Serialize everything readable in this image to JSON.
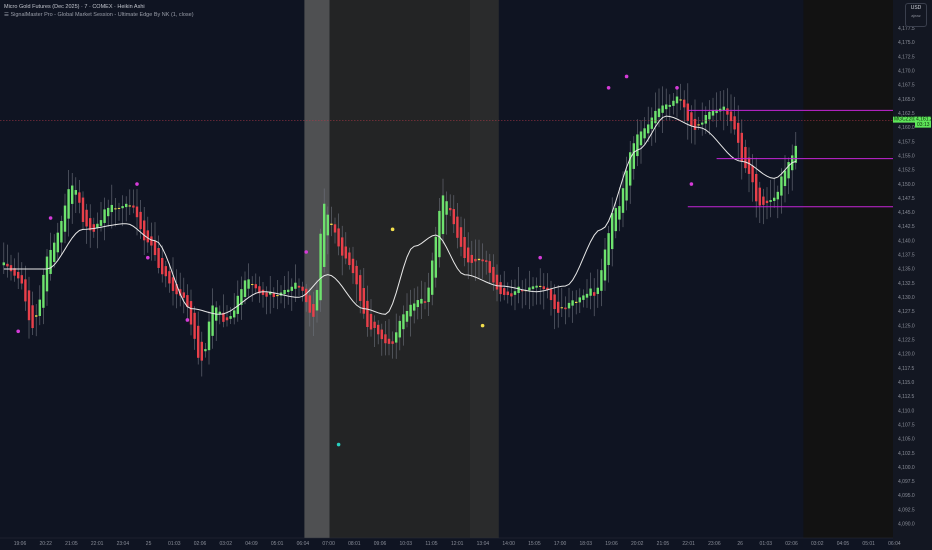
{
  "legend": {
    "symbol": "Micro Gold Futures (Dec 2025) · 7 · COMEX · Heikin Ashi",
    "indicator": "☰ SignalMaster Pro - Global Market Session - Ultimate Edge By NK",
    "indicator_params": "(1, close)"
  },
  "currency": {
    "label": "USD",
    "sub": "ajeaz"
  },
  "colors": {
    "background": "#0f1422",
    "bull": "#6ee26e",
    "bear": "#e8404a",
    "doji": "#f4e04d",
    "ma": "#e8e8e8",
    "signal_up": "#d53bd8",
    "signal_alt": "#f4e04d",
    "signal_low": "#28d0c0",
    "level_line": "#c424d6",
    "price_tag": "#5fe65a",
    "session_band_light": "#5a5a5a",
    "session_band_dark": "#262626"
  },
  "price_tag": {
    "symbol": "MGCZ2025",
    "price": "4,161.2",
    "countdown": "03:13"
  },
  "chart_data": {
    "type": "candlestick",
    "chart_style": "Heikin Ashi",
    "ylim": [
      4087.5,
      4182.5
    ],
    "y_ticks": [
      "4,177.5",
      "4,175.0",
      "4,172.5",
      "4,170.0",
      "4,167.5",
      "4,165.0",
      "4,162.5",
      "4,160.0",
      "4,157.5",
      "4,155.0",
      "4,152.5",
      "4,150.0",
      "4,147.5",
      "4,145.0",
      "4,142.5",
      "4,140.0",
      "4,137.5",
      "4,135.0",
      "4,132.5",
      "4,130.0",
      "4,127.5",
      "4,125.0",
      "4,122.5",
      "4,120.0",
      "4,117.5",
      "4,115.0",
      "4,112.5",
      "4,110.0",
      "4,107.5",
      "4,105.0",
      "4,102.5",
      "4,100.0",
      "4,097.5",
      "4,095.0",
      "4,092.5",
      "4,090.0"
    ],
    "x_ticks": [
      "19:06",
      "20:22",
      "21:05",
      "22:01",
      "23:04",
      "25",
      "01:03",
      "02:06",
      "03:02",
      "04:09",
      "05:01",
      "06:04",
      "07:00",
      "08:01",
      "09:06",
      "10:03",
      "11:05",
      "12:01",
      "13:04",
      "14:00",
      "15:05",
      "17:00",
      "18:03",
      "19:06",
      "20:02",
      "21:05",
      "22:01",
      "23:06",
      "26",
      "01:03",
      "02:06",
      "03:02",
      "04:05",
      "05:01",
      "06:04"
    ],
    "anchors": [
      [
        0,
        4136
      ],
      [
        4,
        4134
      ],
      [
        8,
        4125
      ],
      [
        13,
        4138
      ],
      [
        19,
        4150
      ],
      [
        24,
        4141
      ],
      [
        30,
        4146
      ],
      [
        35,
        4147
      ],
      [
        40,
        4139
      ],
      [
        45,
        4133
      ],
      [
        50,
        4130
      ],
      [
        55,
        4118
      ],
      [
        58,
        4128
      ],
      [
        62,
        4126
      ],
      [
        67,
        4133
      ],
      [
        72,
        4130
      ],
      [
        77,
        4131
      ],
      [
        81,
        4133
      ],
      [
        86,
        4126
      ],
      [
        89,
        4146
      ],
      [
        95,
        4137
      ],
      [
        102,
        4124
      ],
      [
        107,
        4122
      ],
      [
        112,
        4128
      ],
      [
        117,
        4129
      ],
      [
        122,
        4148
      ],
      [
        129,
        4136
      ],
      [
        134,
        4136
      ],
      [
        138,
        4131
      ],
      [
        144,
        4131
      ],
      [
        150,
        4132
      ],
      [
        154,
        4128
      ],
      [
        158,
        4129
      ],
      [
        164,
        4131
      ],
      [
        170,
        4146
      ],
      [
        176,
        4158
      ],
      [
        182,
        4164
      ],
      [
        187,
        4165
      ],
      [
        192,
        4159
      ],
      [
        196,
        4163
      ],
      [
        200,
        4164
      ],
      [
        203,
        4159
      ],
      [
        206,
        4152
      ],
      [
        210,
        4147
      ],
      [
        214,
        4148
      ],
      [
        217,
        4152
      ],
      [
        220,
        4156
      ]
    ],
    "ma_anchors": [
      [
        0,
        4135
      ],
      [
        12,
        4135
      ],
      [
        22,
        4142
      ],
      [
        34,
        4143
      ],
      [
        42,
        4140
      ],
      [
        52,
        4128
      ],
      [
        60,
        4127
      ],
      [
        72,
        4131
      ],
      [
        82,
        4130
      ],
      [
        90,
        4134
      ],
      [
        100,
        4128
      ],
      [
        106,
        4127
      ],
      [
        114,
        4139
      ],
      [
        120,
        4141
      ],
      [
        128,
        4134
      ],
      [
        138,
        4132
      ],
      [
        148,
        4131
      ],
      [
        156,
        4132
      ],
      [
        166,
        4142
      ],
      [
        176,
        4156
      ],
      [
        184,
        4162
      ],
      [
        193,
        4160
      ],
      [
        205,
        4154
      ],
      [
        214,
        4151
      ],
      [
        220,
        4154
      ]
    ],
    "session_bands": [
      {
        "from_bar": 84,
        "to_bar": 91,
        "shade": "light"
      },
      {
        "from_bar": 91,
        "to_bar": 130,
        "shade": "dark"
      },
      {
        "from_bar": 130,
        "to_bar": 138,
        "shade": "darker"
      }
    ],
    "signals": [
      {
        "bar": 4,
        "price": 4124,
        "color": "signal_up"
      },
      {
        "bar": 13,
        "price": 4144,
        "color": "signal_up"
      },
      {
        "bar": 37,
        "price": 4150,
        "color": "signal_up"
      },
      {
        "bar": 40,
        "price": 4137,
        "color": "signal_up"
      },
      {
        "bar": 51,
        "price": 4126,
        "color": "signal_up"
      },
      {
        "bar": 84,
        "price": 4138,
        "color": "signal_up"
      },
      {
        "bar": 93,
        "price": 4104,
        "color": "signal_low"
      },
      {
        "bar": 108,
        "price": 4142,
        "color": "signal_alt"
      },
      {
        "bar": 133,
        "price": 4125,
        "color": "signal_alt"
      },
      {
        "bar": 149,
        "price": 4137,
        "color": "signal_up"
      },
      {
        "bar": 168,
        "price": 4167,
        "color": "signal_up"
      },
      {
        "bar": 173,
        "price": 4169,
        "color": "signal_up"
      },
      {
        "bar": 187,
        "price": 4167,
        "color": "signal_up"
      },
      {
        "bar": 191,
        "price": 4150,
        "color": "signal_up"
      }
    ],
    "levels": [
      {
        "price": 4163.0,
        "from_bar": 190
      },
      {
        "price": 4154.5,
        "from_bar": 198
      },
      {
        "price": 4146.0,
        "from_bar": 190
      }
    ],
    "current_price": 4161.2
  }
}
